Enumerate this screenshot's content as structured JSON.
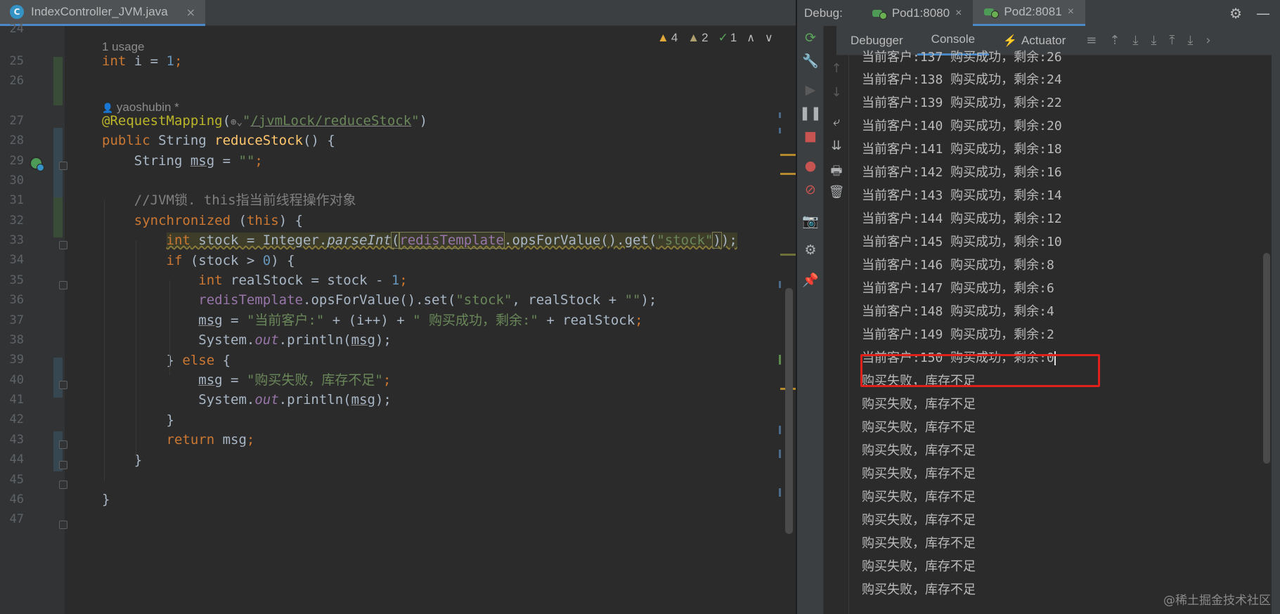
{
  "editor": {
    "file_tab": {
      "icon_letter": "C",
      "name": "IndexController_JVM.java",
      "close": "×"
    },
    "inspections": {
      "warnings": "4",
      "weak_warnings": "2",
      "typos": "1",
      "up": "∧",
      "down": "∨"
    },
    "hints": {
      "usage": "1 usage",
      "author": "yaoshubin *"
    },
    "line_numbers": [
      "24",
      "25",
      "26",
      "27",
      "28",
      "29",
      "30",
      "31",
      "32",
      "33",
      "34",
      "35",
      "36",
      "37",
      "38",
      "39",
      "40",
      "41",
      "42",
      "43",
      "44",
      "45",
      "46",
      "47"
    ],
    "code": {
      "l25": {
        "kw": "int",
        "rest": " i = ",
        "num": "1",
        "end": ";"
      },
      "l27": {
        "ann": "@RequestMapping",
        "open": "(",
        "icons": "⊕⌄",
        "q1": "\"",
        "path": "/jvmLock/reduceStock",
        "q2": "\"",
        "close": ")"
      },
      "l28": {
        "kw": "public",
        "type": " String ",
        "fn": "reduceStock",
        "rest": "() {"
      },
      "l29": {
        "pre": "    String ",
        "var": "msg",
        "mid": " = ",
        "str": "\"\"",
        "end": ";"
      },
      "l31": {
        "comment": "    //JVM锁. this指当前线程操作对象"
      },
      "l32": {
        "pre": "    ",
        "kw": "synchronized",
        "mid": " (",
        "kw2": "this",
        "end": ") {"
      },
      "l33": {
        "pre": "        ",
        "kw": "int",
        "a": " stock = Integer.",
        "fn": "parseInt",
        "b": "(",
        "fld": "redisTemplate",
        "c": ".opsForValue().get(",
        "str": "\"stock\"",
        "d": ")",
        "end": ");"
      },
      "l34": {
        "pre": "        ",
        "kw": "if",
        "rest": " (stock > ",
        "num": "0",
        "end": ") {"
      },
      "l35": {
        "pre": "            ",
        "kw": "int",
        "rest": " realStock = stock - ",
        "num": "1",
        "end": ";"
      },
      "l36": {
        "pre": "            ",
        "fld": "redisTemplate",
        "a": ".opsForValue().set(",
        "str": "\"stock\"",
        "b": ", realStock + ",
        "str2": "\"\"",
        "end": ");"
      },
      "l37": {
        "pre": "            ",
        "var": "msg",
        "a": " = ",
        "str": "\"当前客户:\"",
        "b": " + (i++) + ",
        "str2": "\" 购买成功，剩余:\"",
        "c": " + realStock",
        "end": ";"
      },
      "l38": {
        "pre": "            System.",
        "fld": "out",
        "a": ".println(",
        "var": "msg",
        "end": ");"
      },
      "l39": {
        "pre": "        } ",
        "kw": "else",
        "end": " {"
      },
      "l40": {
        "pre": "            ",
        "var": "msg",
        "a": " = ",
        "str": "\"购买失败，库存不足\"",
        "end": ";"
      },
      "l41": {
        "pre": "            System.",
        "fld": "out",
        "a": ".println(",
        "var": "msg",
        "end": ");"
      },
      "l42": {
        "text": "        }"
      },
      "l43": {
        "pre": "        ",
        "kw": "return",
        "rest": " msg",
        "end": ";"
      },
      "l44": {
        "text": "    }"
      },
      "l46": {
        "text": "}"
      }
    }
  },
  "debug": {
    "label": "Debug:",
    "pods": [
      {
        "name": "Pod1:8080",
        "close": "×"
      },
      {
        "name": "Pod2:8081",
        "close": "×"
      }
    ],
    "header_icons": {
      "settings": "⚙",
      "minimize": "—"
    },
    "tabs": {
      "debugger": "Debugger",
      "console": "Console",
      "actuator": "Actuator"
    },
    "toolbar_glyphs": {
      "menu": "≡",
      "t1": "⇡",
      "t2": "⤓",
      "t3": "⤓",
      "t4": "⤒",
      "t5": "⤓",
      "more": "›"
    },
    "console_lines": [
      "当前客户:137 购买成功，剩余:26",
      "当前客户:138 购买成功，剩余:24",
      "当前客户:139 购买成功，剩余:22",
      "当前客户:140 购买成功，剩余:20",
      "当前客户:141 购买成功，剩余:18",
      "当前客户:142 购买成功，剩余:16",
      "当前客户:143 购买成功，剩余:14",
      "当前客户:144 购买成功，剩余:12",
      "当前客户:145 购买成功，剩余:10",
      "当前客户:146 购买成功，剩余:8",
      "当前客户:147 购买成功，剩余:6",
      "当前客户:148 购买成功，剩余:4",
      "当前客户:149 购买成功，剩余:2",
      "当前客户:150 购买成功，剩余:0",
      "购买失败，库存不足",
      "购买失败，库存不足",
      "购买失败，库存不足",
      "购买失败，库存不足",
      "购买失败，库存不足",
      "购买失败，库存不足",
      "购买失败，库存不足",
      "购买失败，库存不足",
      "购买失败，库存不足",
      "购买失败，库存不足"
    ]
  },
  "watermark": "@稀土掘金技术社区",
  "colors": {
    "highlight_box": "#e0211b",
    "accent": "#4a88c7",
    "keyword": "#cc7832",
    "string": "#6a8759"
  }
}
